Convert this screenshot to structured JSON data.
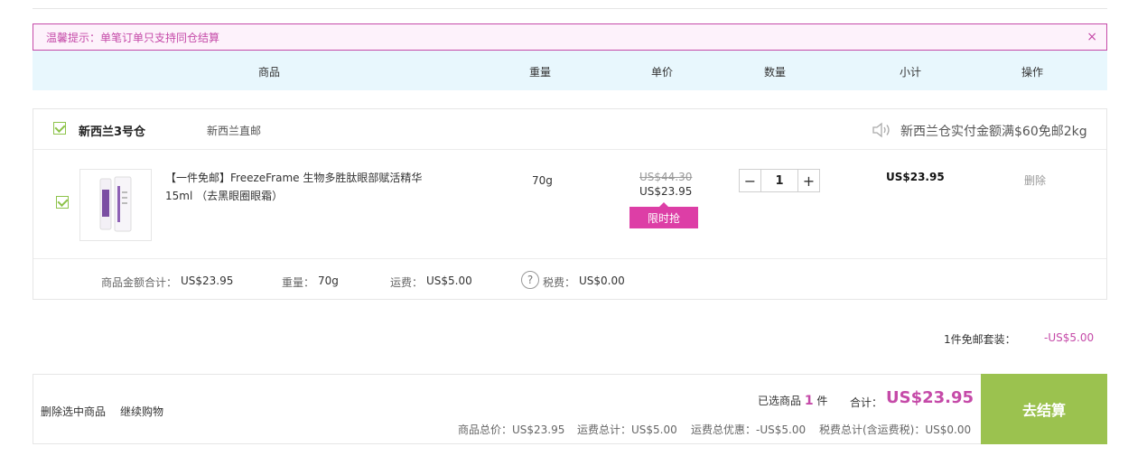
{
  "notice": {
    "text": "温馨提示：单笔订单只支持同仓结算",
    "close": "×"
  },
  "table_header": {
    "columns": [
      "商品",
      "重量",
      "单价",
      "数量",
      "小计",
      "操作"
    ]
  },
  "warehouse": {
    "name": "新西兰3号仓",
    "tag": "新西兰直邮",
    "promo": "新西兰仓实付金额满$60免邮2kg"
  },
  "item": {
    "name": "【一件免邮】FreezeFrame 生物多胜肽眼部赋活精华15ml （去黑眼圈眼霜）",
    "weight": "70g",
    "original_price": "US$44.30",
    "current_price": "US$23.95",
    "flash_tag": "限时抢",
    "quantity": "1",
    "minus": "−",
    "plus": "+",
    "subtotal": "US$23.95",
    "delete": "删除"
  },
  "summary": {
    "goods_label": "商品金额合计：",
    "goods_value": "US$23.95",
    "weight_label": "重量：",
    "weight_value": "70g",
    "shipping_label": "运费：",
    "shipping_value": "US$5.00",
    "tax_icon": "?",
    "tax_label": "税费：",
    "tax_value": "US$0.00"
  },
  "free_package": {
    "label": "1件免邮套装：",
    "value": "-US$5.00"
  },
  "footer": {
    "delete_selected": "删除选中商品",
    "continue_shopping": "继续购物",
    "selected_prefix": "已选商品",
    "selected_count": "1",
    "selected_suffix": "件",
    "total_label": "合计：",
    "total_value": "US$23.95",
    "detail_goods": "商品总价：US$23.95",
    "detail_shipping": "运费总计：US$5.00",
    "detail_discount": "运费总优惠：-US$5.00",
    "detail_tax": "税费总计(含运费税)：US$0.00",
    "checkout": "去结算"
  },
  "colors": {
    "accent": "#c54aa8",
    "checkout_bg": "#9bc24f",
    "header_bg": "#e8f7fd",
    "flash_bg": "#dd3ea6"
  }
}
